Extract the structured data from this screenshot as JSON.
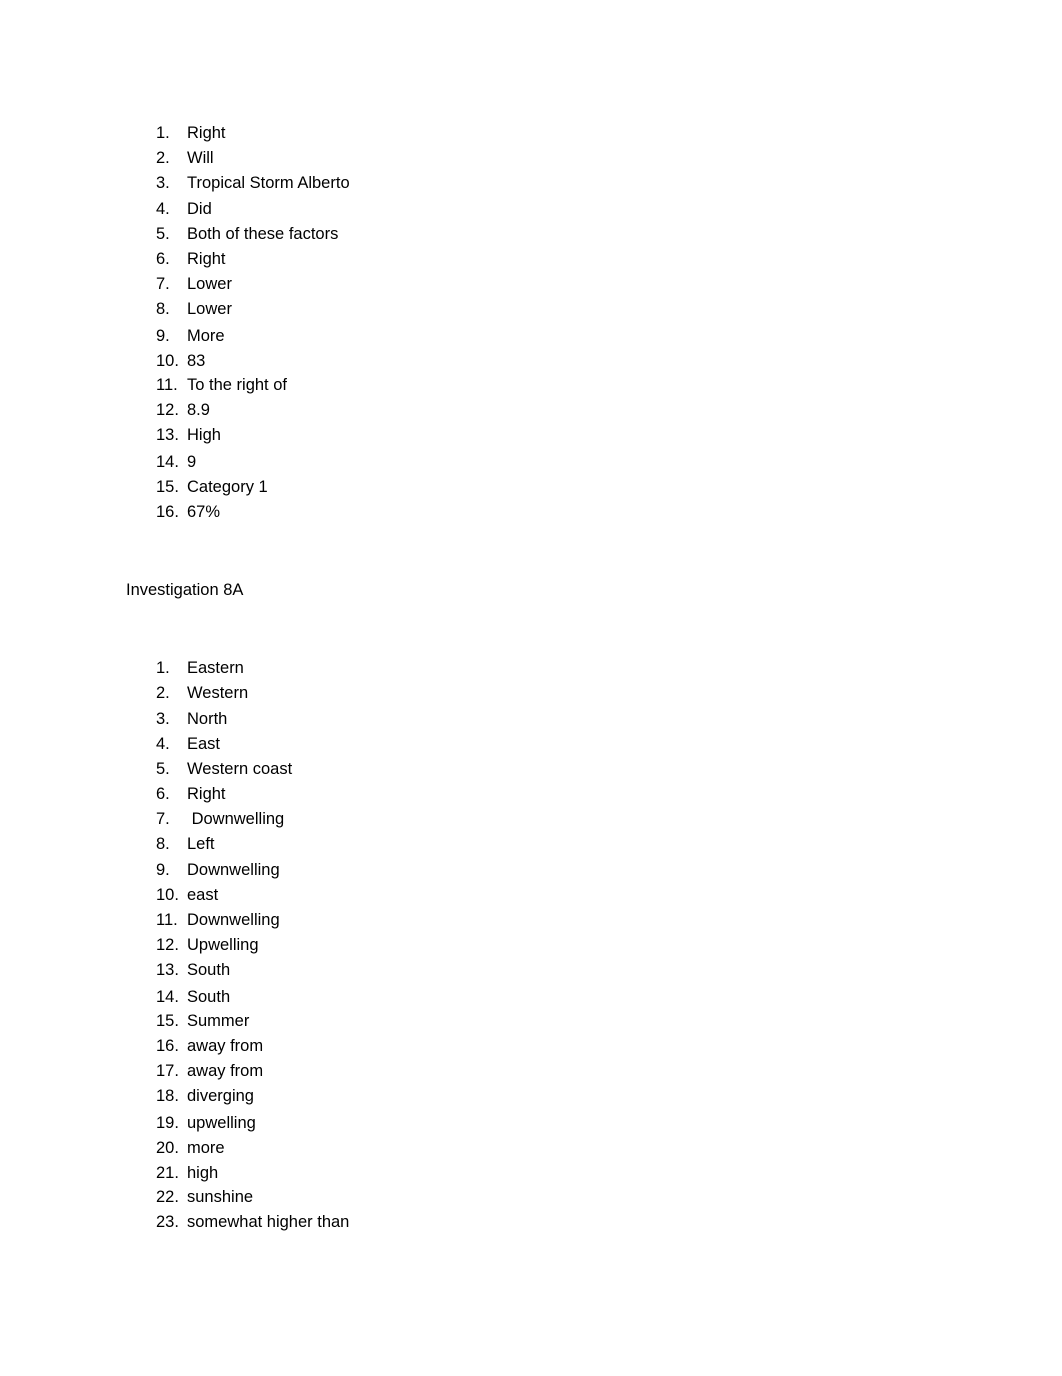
{
  "document": {
    "list1": {
      "items": [
        {
          "number": "1.",
          "answer": "Right"
        },
        {
          "number": "2.",
          "answer": "Will"
        },
        {
          "number": "3.",
          "answer": "Tropical Storm Alberto"
        },
        {
          "number": "4.",
          "answer": "Did"
        },
        {
          "number": "5.",
          "answer": "Both of these factors"
        },
        {
          "number": "6.",
          "answer": "Right"
        },
        {
          "number": "7.",
          "answer": "Lower"
        },
        {
          "number": "8.",
          "answer": "Lower"
        },
        {
          "number": "9.",
          "answer": "More"
        },
        {
          "number": "10.",
          "answer": "83"
        },
        {
          "number": "11.",
          "answer": "To the right of"
        },
        {
          "number": "12.",
          "answer": "8.9"
        },
        {
          "number": "13.",
          "answer": "High"
        },
        {
          "number": "14.",
          "answer": "9"
        },
        {
          "number": "15.",
          "answer": "Category 1"
        },
        {
          "number": "16.",
          "answer": "67%"
        }
      ]
    },
    "section_heading": "Investigation 8A",
    "list2": {
      "items": [
        {
          "number": "1.",
          "answer": "Eastern"
        },
        {
          "number": "2.",
          "answer": "Western"
        },
        {
          "number": "3.",
          "answer": "North"
        },
        {
          "number": "4.",
          "answer": "East"
        },
        {
          "number": "5.",
          "answer": "Western coast"
        },
        {
          "number": "6.",
          "answer": "Right"
        },
        {
          "number": "7.",
          "answer": " Downwelling"
        },
        {
          "number": "8.",
          "answer": "Left"
        },
        {
          "number": "9.",
          "answer": "Downwelling"
        },
        {
          "number": "10.",
          "answer": "east"
        },
        {
          "number": "11.",
          "answer": "Downwelling"
        },
        {
          "number": "12.",
          "answer": "Upwelling"
        },
        {
          "number": "13.",
          "answer": "South"
        },
        {
          "number": "14.",
          "answer": "South"
        },
        {
          "number": "15.",
          "answer": "Summer"
        },
        {
          "number": "16.",
          "answer": "away from"
        },
        {
          "number": "17.",
          "answer": "away from"
        },
        {
          "number": "18.",
          "answer": "diverging"
        },
        {
          "number": "19.",
          "answer": "upwelling"
        },
        {
          "number": "20.",
          "answer": "more"
        },
        {
          "number": "21.",
          "answer": "high"
        },
        {
          "number": "22.",
          "answer": "sunshine"
        },
        {
          "number": "23.",
          "answer": "somewhat higher than"
        }
      ]
    }
  }
}
